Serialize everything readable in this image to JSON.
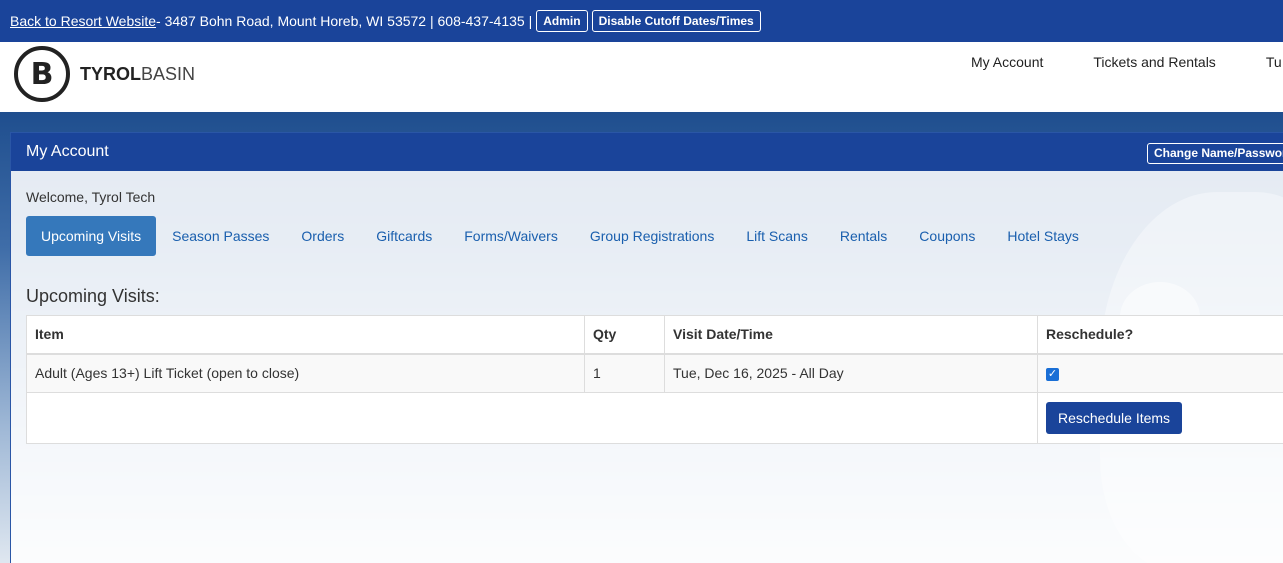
{
  "topbar": {
    "back_link": "Back to Resort Website",
    "address": " - 3487 Bohn Road, Mount Horeb, WI 53572 | 608-437-4135 |",
    "admin_label": "Admin",
    "disable_cutoff_label": "Disable Cutoff Dates/Times"
  },
  "logo": {
    "mark": "B",
    "word_bold": "TYROL",
    "word_light": "BASIN"
  },
  "nav": {
    "items": [
      "My Account",
      "Tickets and Rentals",
      "Tu"
    ]
  },
  "panel": {
    "title": "My Account",
    "change_button": "Change Name/Password",
    "welcome": "Welcome, Tyrol Tech",
    "tabs": [
      "Upcoming Visits",
      "Season Passes",
      "Orders",
      "Giftcards",
      "Forms/Waivers",
      "Group Registrations",
      "Lift Scans",
      "Rentals",
      "Coupons",
      "Hotel Stays"
    ],
    "active_tab": "Upcoming Visits",
    "section_title": "Upcoming Visits:"
  },
  "table": {
    "headers": [
      "Item",
      "Qty",
      "Visit Date/Time",
      "Reschedule?"
    ],
    "rows": [
      {
        "item": "Adult (Ages 13+) Lift Ticket (open to close)",
        "qty": "1",
        "date": "Tue, Dec 16, 2025 - All Day",
        "reschedule": true
      }
    ],
    "reschedule_button": "Reschedule Items"
  },
  "colors": {
    "brand": "#1a449a",
    "active_tab": "#3578bb",
    "link": "#1a5fae"
  }
}
